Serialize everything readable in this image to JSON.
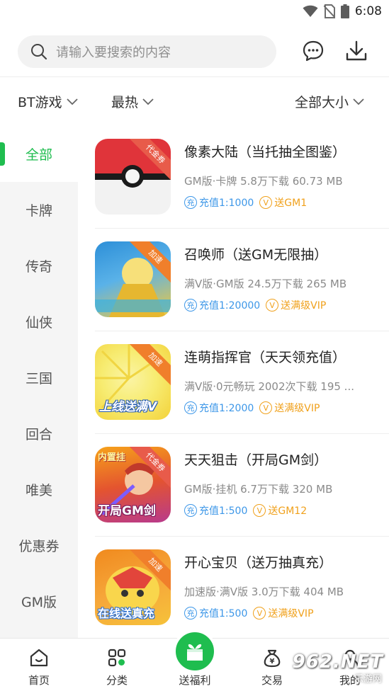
{
  "status_bar": {
    "time": "6:08"
  },
  "search": {
    "placeholder": "请输入要搜索的内容"
  },
  "filters": [
    {
      "label": "BT游戏"
    },
    {
      "label": "最热"
    },
    {
      "label": "全部大小"
    }
  ],
  "sidebar": {
    "items": [
      {
        "label": "全部",
        "active": true
      },
      {
        "label": "卡牌"
      },
      {
        "label": "传奇"
      },
      {
        "label": "仙侠"
      },
      {
        "label": "三国"
      },
      {
        "label": "回合"
      },
      {
        "label": "唯美"
      },
      {
        "label": "优惠券"
      },
      {
        "label": "GM版"
      }
    ]
  },
  "games": [
    {
      "title": "像素大陆（当托抽全图鉴）",
      "meta": "GM版·卡牌  5.8万下载  60.73 MB",
      "ribbon": "代金券",
      "recharge": "充值1:1000",
      "vip": "送GM1",
      "icon_colors": {
        "top": "#e0343a",
        "bottom": "#f2f2f2"
      }
    },
    {
      "title": "召唤师（送GM无限抽）",
      "meta": "满V版·GM版  24.5万下载  265 MB",
      "ribbon": "加速",
      "recharge": "充值1:20000",
      "vip": "送满级VIP",
      "icon_colors": {
        "top": "#2d8fd8",
        "bottom": "#f4c93a"
      }
    },
    {
      "title": "连萌指挥官（天天领充值）",
      "meta": "满V版·0元畅玩  2002次下载  195 ...",
      "ribbon": "加速",
      "recharge": "充值1:2000",
      "vip": "送满级VIP",
      "icon_text": "上线送满V",
      "icon_colors": {
        "top": "#f7ec72",
        "bottom": "#f3d23a"
      }
    },
    {
      "title": "天天狙击（开局GM剑）",
      "meta": "GM版·挂机  6.7万下载  320 MB",
      "ribbon": "代金券",
      "recharge": "充值1:500",
      "vip": "送GM12",
      "icon_text_top": "内置挂",
      "icon_text": "开局GM剑",
      "icon_colors": {
        "top": "#f6a21b",
        "bottom": "#b83a8c"
      }
    },
    {
      "title": "开心宝贝（送万抽真充）",
      "meta": "加速版·满V版  3.0万下载  404 MB",
      "ribbon": "加速",
      "recharge": "充值1:500",
      "vip": "送满级VIP",
      "icon_text": "在线送真充",
      "icon_colors": {
        "top": "#f08a1e",
        "bottom": "#f6c23a"
      }
    }
  ],
  "bottom_nav": [
    {
      "label": "首页"
    },
    {
      "label": "分类"
    },
    {
      "label": "送福利"
    },
    {
      "label": "交易"
    },
    {
      "label": "我的"
    }
  ],
  "watermark": {
    "main": "962.NET",
    "sub": "乐游网"
  },
  "colors": {
    "accent": "#1fbd4f",
    "recharge_blue": "#3d97e8",
    "vip_gold": "#f0a11c"
  }
}
